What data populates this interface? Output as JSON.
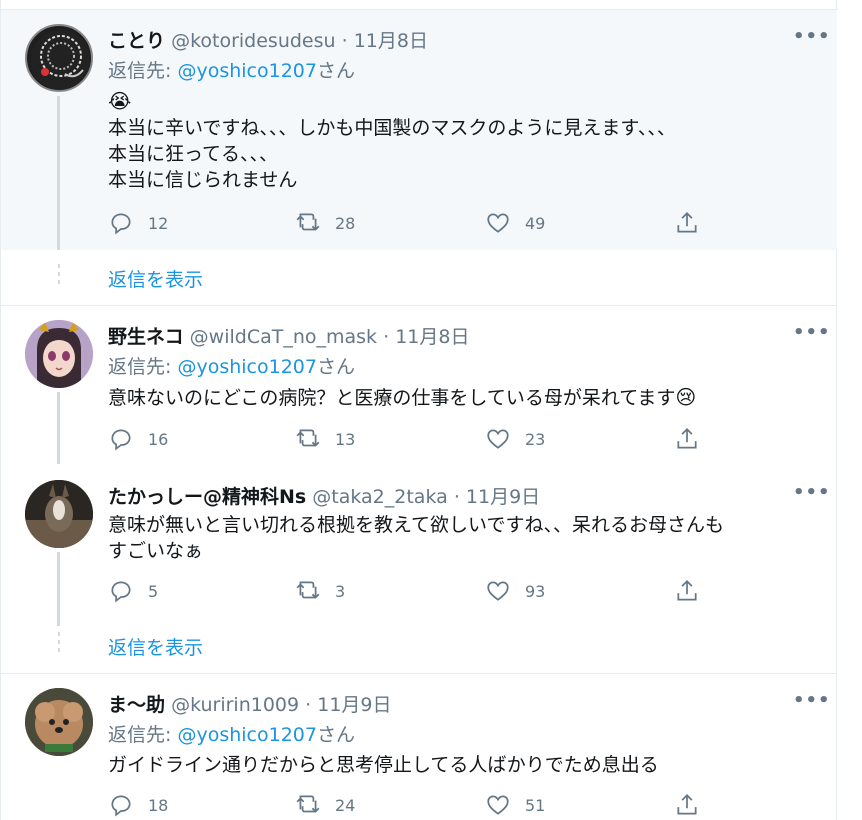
{
  "tweets": [
    {
      "name": "ことり",
      "handle": "@kotoridesudesu",
      "date": "11月8日",
      "reply_prefix": "返信先:",
      "reply_mention": "@yoshico1207",
      "reply_suffix": "さん",
      "emoji": "😭",
      "lines": [
        "本当に辛いですね、、、しかも中国製のマスクのように見えます、、、",
        "本当に狂ってる、、、",
        "本当に信じられません"
      ],
      "replies": "12",
      "retweets": "28",
      "likes": "49"
    },
    {
      "name": "野生ネコ",
      "handle": "@wildCaT_no_mask",
      "date": "11月8日",
      "reply_prefix": "返信先:",
      "reply_mention": "@yoshico1207",
      "reply_suffix": "さん",
      "lines": [
        "意味ないのにどこの病院？と医療の仕事をしている母が呆れてます"
      ],
      "emoji_end": "😢",
      "replies": "16",
      "retweets": "13",
      "likes": "23"
    },
    {
      "name": "たかっしー@精神科Ns",
      "handle": "@taka2_2taka",
      "date": "11月9日",
      "lines": [
        "意味が無いと言い切れる根拠を教えて欲しいですね、、呆れるお母さんも",
        "すごいなぁ"
      ],
      "replies": "5",
      "retweets": "3",
      "likes": "93"
    },
    {
      "name": "ま〜助",
      "handle": "@kuririn1009",
      "date": "11月9日",
      "reply_prefix": "返信先:",
      "reply_mention": "@yoshico1207",
      "reply_suffix": "さん",
      "lines": [
        "ガイドライン通りだからと思考停止してる人ばかりでため息出る"
      ],
      "replies": "18",
      "retweets": "24",
      "likes": "51"
    }
  ],
  "show_replies_label": "返信を表示",
  "separator": "·",
  "more_label": "•••",
  "colors": {
    "link": "#1b95e0",
    "muted": "#657786",
    "highlight_bg": "#f5f8fa"
  },
  "icons": [
    "reply-icon",
    "retweet-icon",
    "like-icon",
    "share-icon",
    "more-icon"
  ]
}
